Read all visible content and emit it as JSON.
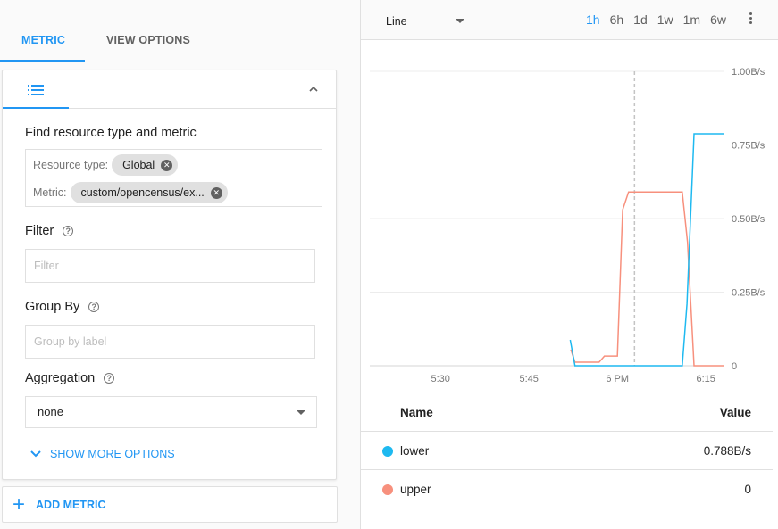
{
  "tabs": [
    {
      "label": "METRIC",
      "active": true
    },
    {
      "label": "VIEW OPTIONS",
      "active": false
    }
  ],
  "metric_card": {
    "find_label": "Find resource type and metric",
    "resource_type_label": "Resource type:",
    "resource_type_value": "Global",
    "metric_label": "Metric:",
    "metric_value": "custom/opencensus/ex...",
    "filter_label": "Filter",
    "filter_placeholder": "Filter",
    "filter_value": "",
    "group_by_label": "Group By",
    "group_by_placeholder": "Group by label",
    "group_by_value": "",
    "aggregation_label": "Aggregation",
    "aggregation_value": "none",
    "show_more_label": "SHOW MORE OPTIONS",
    "help_glyph": "?"
  },
  "add_metric_label": "ADD METRIC",
  "toolbar": {
    "chart_type": "Line",
    "ranges": [
      "1h",
      "6h",
      "1d",
      "1w",
      "1m",
      "6w"
    ],
    "active_range": "1h"
  },
  "colors": {
    "accent": "#2196f3",
    "lower": "#1eb9f0",
    "upper": "#f7907d"
  },
  "chart_data": {
    "type": "line",
    "title": "",
    "xlabel": "",
    "ylabel": "",
    "x_unit": "minutes since 5:00 PM",
    "xlim": [
      18,
      78
    ],
    "ylim": [
      0,
      1.0
    ],
    "x_ticks": [
      {
        "x": 30,
        "label": "5:30"
      },
      {
        "x": 45,
        "label": "5:45"
      },
      {
        "x": 60,
        "label": "6 PM"
      },
      {
        "x": 75,
        "label": "6:15"
      }
    ],
    "y_ticks": [
      {
        "y": 0,
        "label": "0"
      },
      {
        "y": 0.25,
        "label": "0.25B/s"
      },
      {
        "y": 0.5,
        "label": "0.50B/s"
      },
      {
        "y": 0.75,
        "label": "0.75B/s"
      },
      {
        "y": 1.0,
        "label": "1.00B/s"
      }
    ],
    "cursor_x": 62.9,
    "grid": true,
    "series": [
      {
        "name": "lower",
        "color": "#1eb9f0",
        "points": [
          [
            52.0,
            0.088
          ],
          [
            52.8,
            0
          ],
          [
            71.0,
            0
          ],
          [
            71.8,
            0.21
          ],
          [
            73.0,
            0.788
          ],
          [
            78,
            0.788
          ]
        ]
      },
      {
        "name": "upper",
        "color": "#f7907d",
        "points": [
          [
            52.1,
            0.055
          ],
          [
            52.8,
            0.012
          ],
          [
            56.9,
            0.012
          ],
          [
            57.8,
            0.033
          ],
          [
            60.0,
            0.033
          ],
          [
            60.9,
            0.53
          ],
          [
            61.9,
            0.59
          ],
          [
            71.0,
            0.59
          ],
          [
            71.9,
            0.42
          ],
          [
            73.0,
            0
          ],
          [
            78,
            0
          ]
        ]
      }
    ]
  },
  "legend_table": {
    "headers": {
      "name": "Name",
      "value": "Value"
    },
    "rows": [
      {
        "name": "lower",
        "value": "0.788B/s",
        "color": "#1eb9f0"
      },
      {
        "name": "upper",
        "value": "0",
        "color": "#f7907d"
      }
    ]
  }
}
